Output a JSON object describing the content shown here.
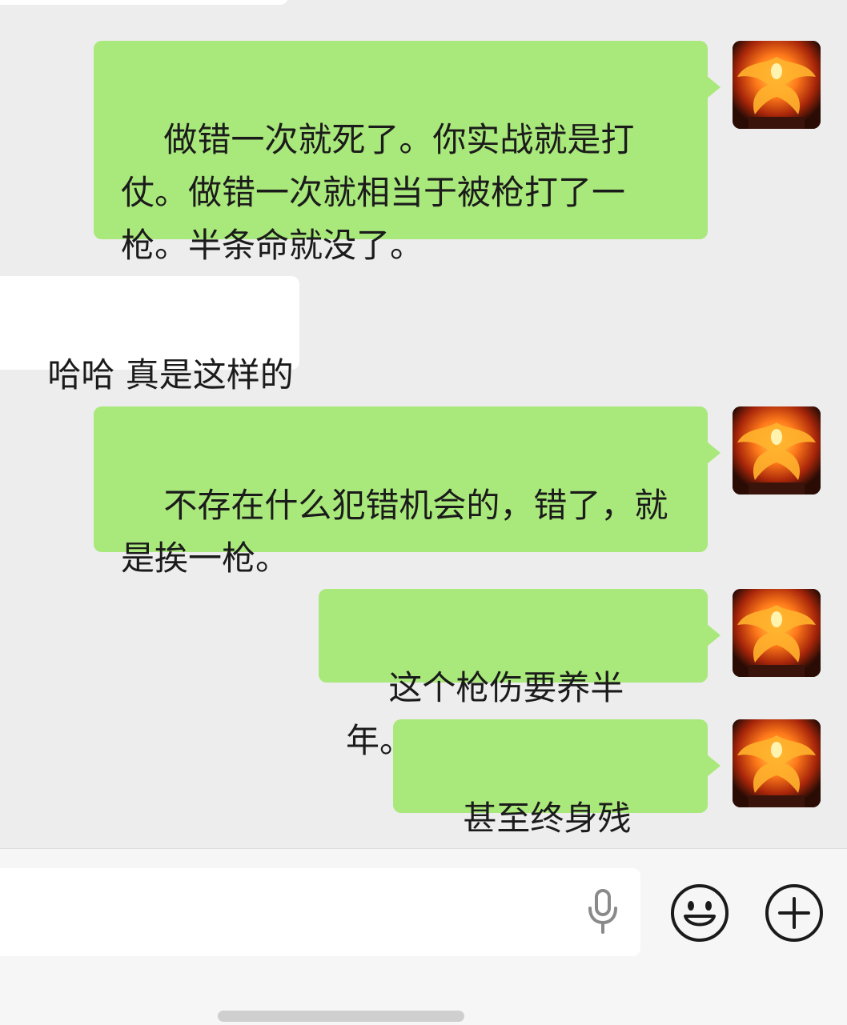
{
  "messages": [
    {
      "side": "sent",
      "text": "做错一次就死了。你实战就是打\n仗。做错一次就相当于被枪打了一\n枪。半条命就没了。"
    },
    {
      "side": "received",
      "text": "哈哈 真是这样的"
    },
    {
      "side": "sent",
      "text": "不存在什么犯错机会的，错了，就\n是挨一枪。"
    },
    {
      "side": "sent",
      "text": "这个枪伤要养半年。"
    },
    {
      "side": "sent",
      "text": "甚至终身残废。"
    }
  ],
  "input": {
    "value": "",
    "placeholder": ""
  },
  "icons": {
    "mic": "microphone-icon",
    "emoji": "emoji-smile-icon",
    "plus": "plus-circle-icon",
    "avatar": "phoenix-avatar"
  },
  "colors": {
    "chat_background": "#EDEDED",
    "sent_bubble": "#A9E87B",
    "received_bubble": "#FFFFFF",
    "input_bar": "#F6F6F6"
  }
}
